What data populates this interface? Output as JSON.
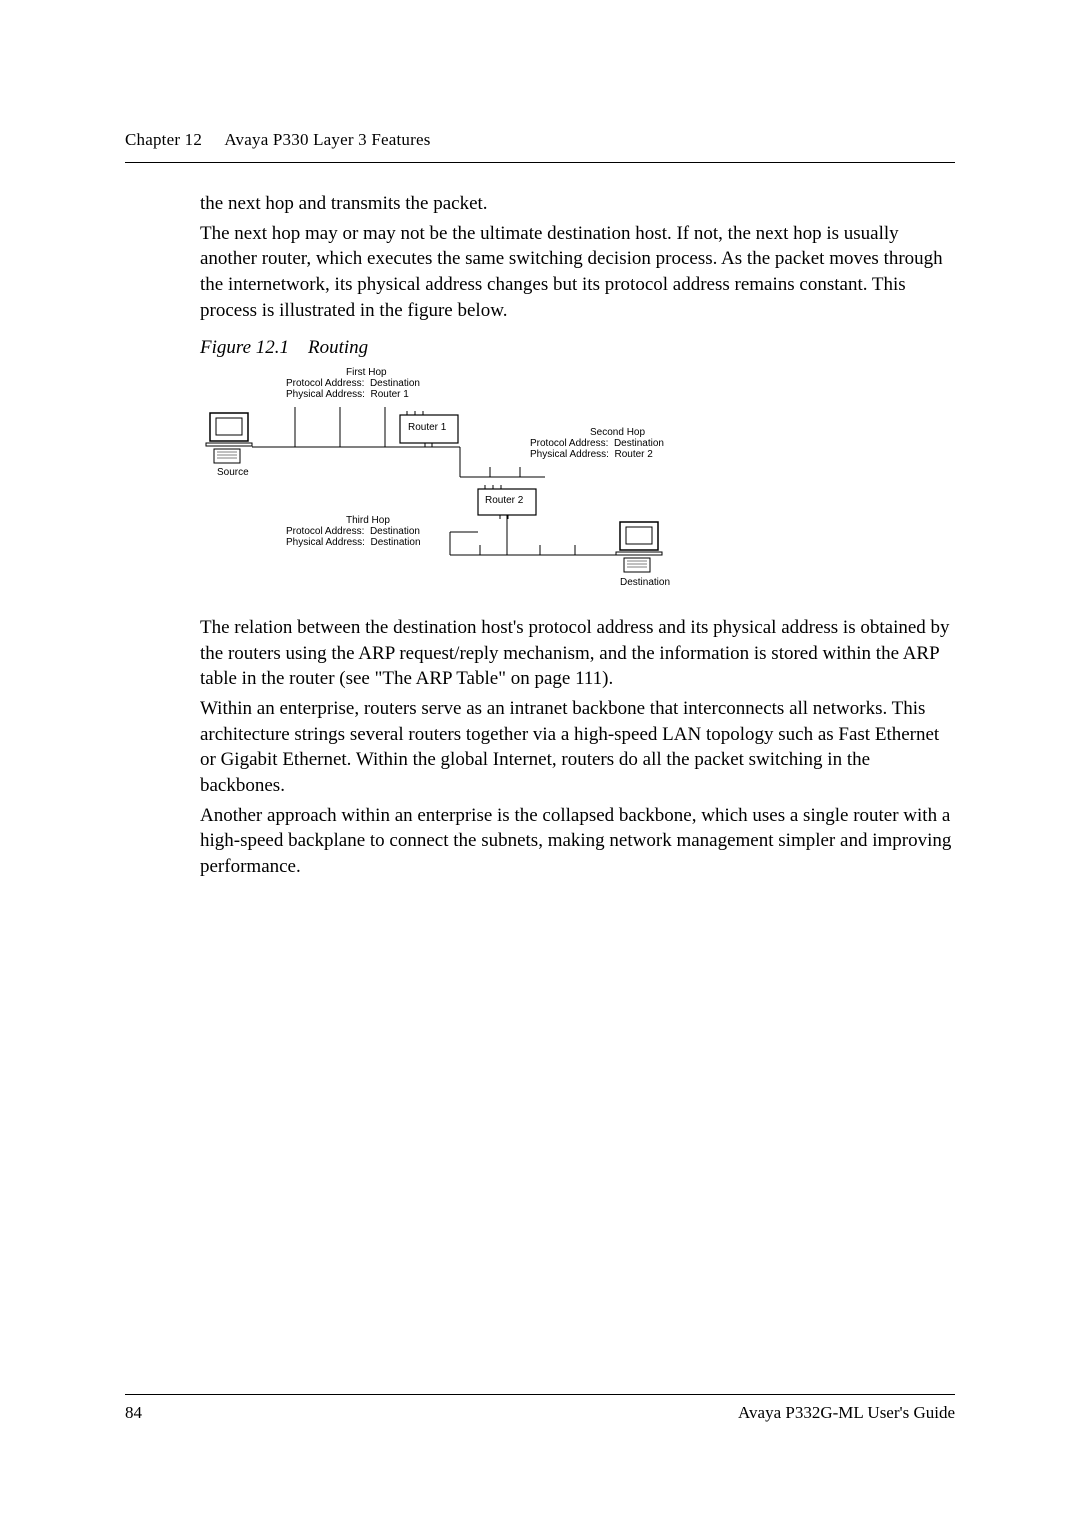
{
  "header": {
    "chapter": "Chapter 12",
    "title": "Avaya P330 Layer 3 Features"
  },
  "paragraphs": {
    "p1": "the next hop and transmits the packet.",
    "p2": "The next hop may or may not be the ultimate destination host. If not, the next hop is usually another router, which executes the same switching decision process. As the packet moves through the internetwork, its physical address changes but its protocol address remains constant. This process is illustrated in the figure below.",
    "p3": "The relation between the destination host's protocol address and its physical address is obtained by the routers using the ARP request/reply mechanism, and the information is stored within the ARP table in the router (see \"The ARP Table\" on page 111).",
    "p4": "Within an enterprise, routers serve as an intranet backbone that interconnects all networks. This architecture strings several routers together via a high-speed LAN topology such as Fast Ethernet or Gigabit Ethernet. Within the global Internet, routers do all the packet switching in the backbones.",
    "p5": "Another approach within an enterprise is the collapsed backbone, which uses a single router with a high-speed backplane to connect the subnets, making network management simpler and improving performance."
  },
  "figure": {
    "caption_prefix": "Figure 12.1",
    "caption_title": "Routing",
    "first_hop": "First Hop",
    "second_hop": "Second Hop",
    "third_hop": "Third Hop",
    "proto_addr": "Protocol Address:",
    "phys_addr": "Physical Address:",
    "dest": "Destination",
    "r1": "Router 1",
    "r2": "Router 2",
    "source": "Source",
    "destination": "Destination"
  },
  "footer": {
    "page_number": "84",
    "guide": "Avaya P332G-ML User's Guide"
  }
}
